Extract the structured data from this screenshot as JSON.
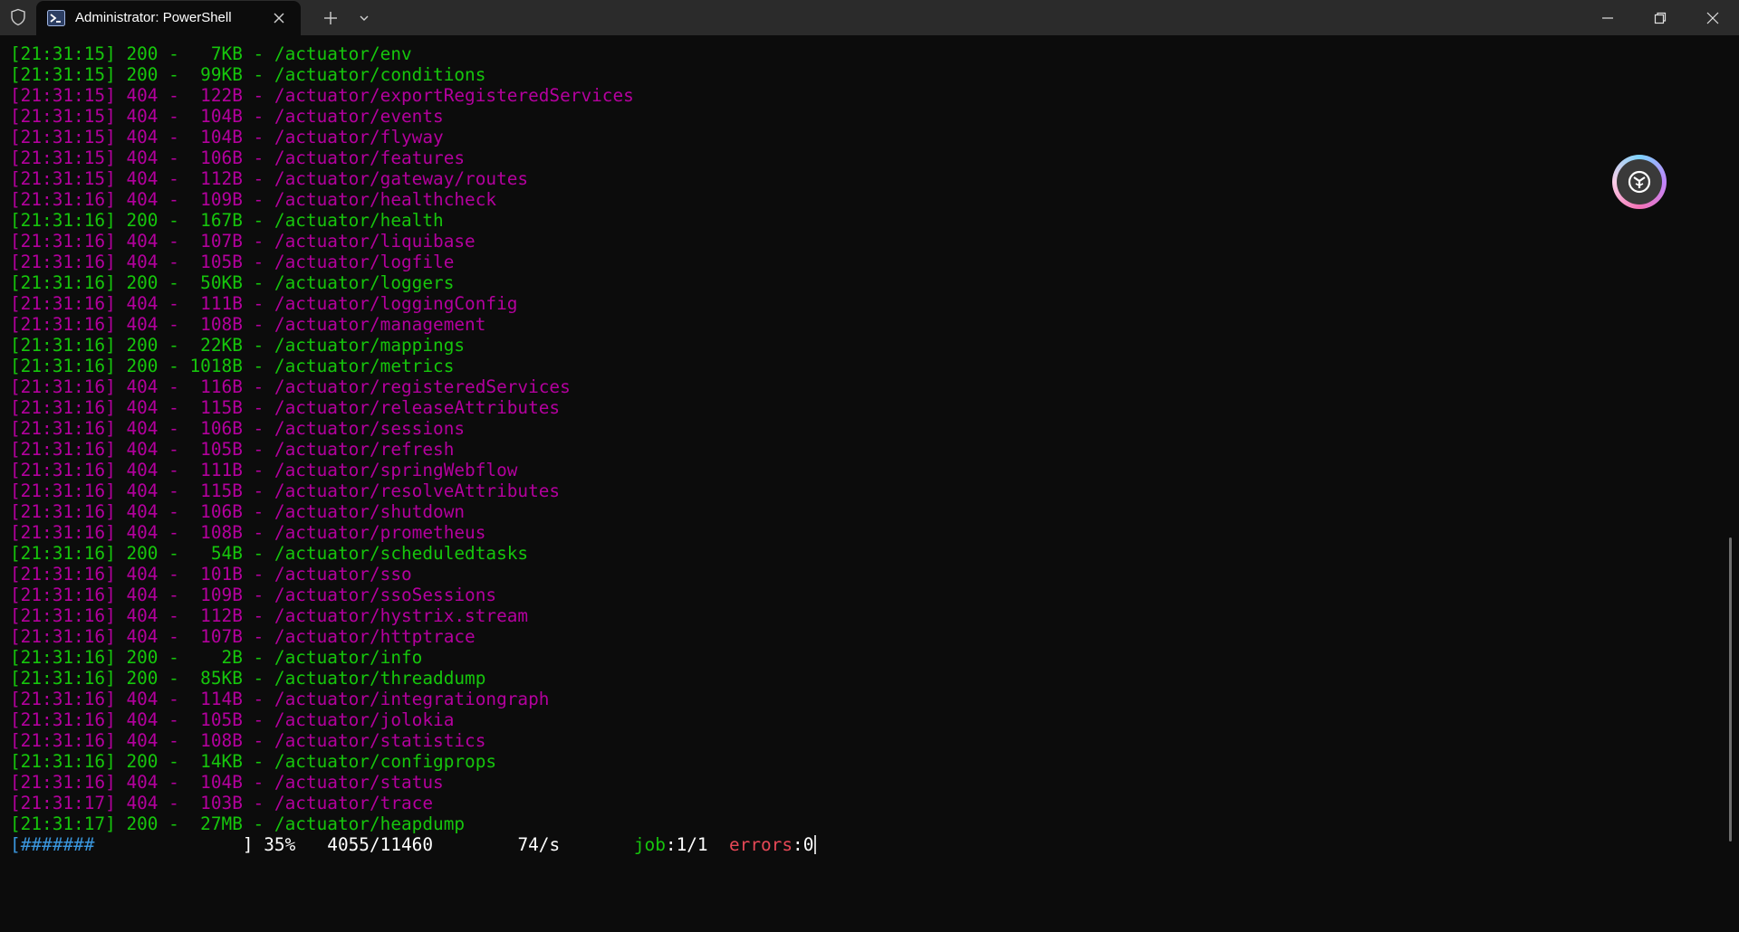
{
  "window": {
    "tab_title": "Administrator: PowerShell"
  },
  "colors": {
    "status_200": "#16c60c",
    "status_404": "#b4009e",
    "errors_label": "#e74856",
    "progress_bar": "#3a96dd"
  },
  "icons": {
    "shield": "shield-icon",
    "powershell": "powershell-icon",
    "close_tab": "close-icon",
    "new_tab": "plus-icon",
    "dropdown": "chevron-down-icon",
    "minimize": "minimize-icon",
    "maximize": "restore-icon",
    "close_window": "close-icon",
    "floating": "assistant-icon"
  },
  "log": [
    {
      "time": "[21:31:15]",
      "status": "200",
      "size": "  7KB",
      "path": "/actuator/env"
    },
    {
      "time": "[21:31:15]",
      "status": "200",
      "size": " 99KB",
      "path": "/actuator/conditions"
    },
    {
      "time": "[21:31:15]",
      "status": "404",
      "size": " 122B",
      "path": "/actuator/exportRegisteredServices"
    },
    {
      "time": "[21:31:15]",
      "status": "404",
      "size": " 104B",
      "path": "/actuator/events"
    },
    {
      "time": "[21:31:15]",
      "status": "404",
      "size": " 104B",
      "path": "/actuator/flyway"
    },
    {
      "time": "[21:31:15]",
      "status": "404",
      "size": " 106B",
      "path": "/actuator/features"
    },
    {
      "time": "[21:31:15]",
      "status": "404",
      "size": " 112B",
      "path": "/actuator/gateway/routes"
    },
    {
      "time": "[21:31:16]",
      "status": "404",
      "size": " 109B",
      "path": "/actuator/healthcheck"
    },
    {
      "time": "[21:31:16]",
      "status": "200",
      "size": " 167B",
      "path": "/actuator/health"
    },
    {
      "time": "[21:31:16]",
      "status": "404",
      "size": " 107B",
      "path": "/actuator/liquibase"
    },
    {
      "time": "[21:31:16]",
      "status": "404",
      "size": " 105B",
      "path": "/actuator/logfile"
    },
    {
      "time": "[21:31:16]",
      "status": "200",
      "size": " 50KB",
      "path": "/actuator/loggers"
    },
    {
      "time": "[21:31:16]",
      "status": "404",
      "size": " 111B",
      "path": "/actuator/loggingConfig"
    },
    {
      "time": "[21:31:16]",
      "status": "404",
      "size": " 108B",
      "path": "/actuator/management"
    },
    {
      "time": "[21:31:16]",
      "status": "200",
      "size": " 22KB",
      "path": "/actuator/mappings"
    },
    {
      "time": "[21:31:16]",
      "status": "200",
      "size": "1018B",
      "path": "/actuator/metrics"
    },
    {
      "time": "[21:31:16]",
      "status": "404",
      "size": " 116B",
      "path": "/actuator/registeredServices"
    },
    {
      "time": "[21:31:16]",
      "status": "404",
      "size": " 115B",
      "path": "/actuator/releaseAttributes"
    },
    {
      "time": "[21:31:16]",
      "status": "404",
      "size": " 106B",
      "path": "/actuator/sessions"
    },
    {
      "time": "[21:31:16]",
      "status": "404",
      "size": " 105B",
      "path": "/actuator/refresh"
    },
    {
      "time": "[21:31:16]",
      "status": "404",
      "size": " 111B",
      "path": "/actuator/springWebflow"
    },
    {
      "time": "[21:31:16]",
      "status": "404",
      "size": " 115B",
      "path": "/actuator/resolveAttributes"
    },
    {
      "time": "[21:31:16]",
      "status": "404",
      "size": " 106B",
      "path": "/actuator/shutdown"
    },
    {
      "time": "[21:31:16]",
      "status": "404",
      "size": " 108B",
      "path": "/actuator/prometheus"
    },
    {
      "time": "[21:31:16]",
      "status": "200",
      "size": "  54B",
      "path": "/actuator/scheduledtasks"
    },
    {
      "time": "[21:31:16]",
      "status": "404",
      "size": " 101B",
      "path": "/actuator/sso"
    },
    {
      "time": "[21:31:16]",
      "status": "404",
      "size": " 109B",
      "path": "/actuator/ssoSessions"
    },
    {
      "time": "[21:31:16]",
      "status": "404",
      "size": " 112B",
      "path": "/actuator/hystrix.stream"
    },
    {
      "time": "[21:31:16]",
      "status": "404",
      "size": " 107B",
      "path": "/actuator/httptrace"
    },
    {
      "time": "[21:31:16]",
      "status": "200",
      "size": "   2B",
      "path": "/actuator/info"
    },
    {
      "time": "[21:31:16]",
      "status": "200",
      "size": " 85KB",
      "path": "/actuator/threaddump"
    },
    {
      "time": "[21:31:16]",
      "status": "404",
      "size": " 114B",
      "path": "/actuator/integrationgraph"
    },
    {
      "time": "[21:31:16]",
      "status": "404",
      "size": " 105B",
      "path": "/actuator/jolokia"
    },
    {
      "time": "[21:31:16]",
      "status": "404",
      "size": " 108B",
      "path": "/actuator/statistics"
    },
    {
      "time": "[21:31:16]",
      "status": "200",
      "size": " 14KB",
      "path": "/actuator/configprops"
    },
    {
      "time": "[21:31:16]",
      "status": "404",
      "size": " 104B",
      "path": "/actuator/status"
    },
    {
      "time": "[21:31:17]",
      "status": "404",
      "size": " 103B",
      "path": "/actuator/trace"
    },
    {
      "time": "[21:31:17]",
      "status": "200",
      "size": " 27MB",
      "path": "/actuator/heapdump"
    }
  ],
  "progress": {
    "bar_open": "[",
    "bar_fill": "#######",
    "bar_rest": "              ] ",
    "percent": "35%",
    "count": "4055/11460",
    "rate": "74/s",
    "job_label": "job",
    "job_value": ":1/1",
    "errors_label": "errors",
    "errors_value": ":0"
  }
}
